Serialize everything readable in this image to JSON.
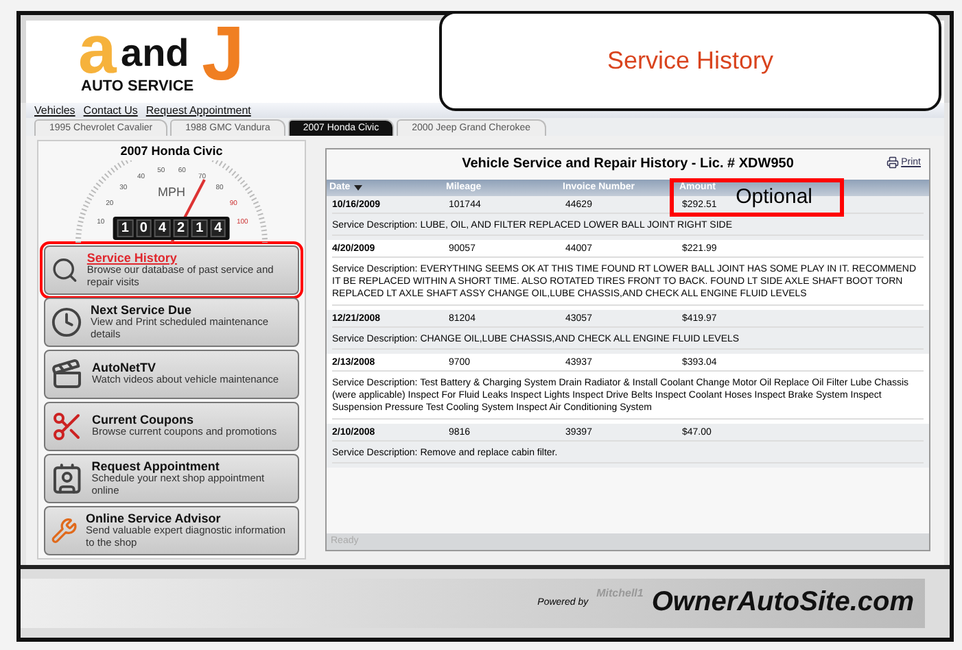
{
  "callout": {
    "text": "Service History"
  },
  "logo": {
    "letter_a": "a",
    "word": "and",
    "letter_j": "J",
    "tagline": "AUTO SERVICE"
  },
  "menu": [
    "Vehicles",
    "Contact Us",
    "Request Appointment"
  ],
  "tabs": [
    {
      "label": "1995 Chevrolet Cavalier",
      "selected": false
    },
    {
      "label": "1988 GMC Vandura",
      "selected": false
    },
    {
      "label": "2007 Honda Civic",
      "selected": true
    },
    {
      "label": "2000 Jeep Grand Cherokee",
      "selected": false
    }
  ],
  "vehicle": {
    "name": "2007 Honda Civic",
    "gauge_unit": "MPH",
    "gauge_labels": [
      "10",
      "20",
      "30",
      "40",
      "50",
      "60",
      "70",
      "80",
      "90",
      "100"
    ],
    "odometer": [
      "1",
      "0",
      "4",
      "2",
      "1",
      "4"
    ]
  },
  "sidebar": [
    {
      "kind": "search",
      "title": "Service History",
      "subtitle": "Browse our database of past service and repair visits",
      "selected": true
    },
    {
      "kind": "clock",
      "title": "Next Service Due",
      "subtitle": "View and Print scheduled maintenance details",
      "selected": false
    },
    {
      "kind": "video",
      "title": "AutoNetTV",
      "subtitle": "Watch videos about vehicle maintenance",
      "selected": false
    },
    {
      "kind": "scissors",
      "title": "Current Coupons",
      "subtitle": "Browse current coupons and promotions",
      "selected": false
    },
    {
      "kind": "card",
      "title": "Request Appointment",
      "subtitle": "Schedule your next shop appointment online",
      "selected": false
    },
    {
      "kind": "wrench",
      "title": "Online Service Advisor",
      "subtitle": "Send valuable expert diagnostic information to the shop",
      "selected": false
    }
  ],
  "history": {
    "title": "Vehicle Service and Repair History - Lic. # XDW950",
    "print": "Print",
    "columns": [
      "Date",
      "Mileage",
      "Invoice Number",
      "Amount"
    ],
    "rows": [
      {
        "date": "10/16/2009",
        "mileage": "101744",
        "invoice": "44629",
        "amount": "$292.51",
        "description": "Service Description: LUBE, OIL, AND FILTER REPLACED LOWER BALL JOINT RIGHT SIDE"
      },
      {
        "date": "4/20/2009",
        "mileage": "90057",
        "invoice": "44007",
        "amount": "$221.99",
        "description": "Service Description: EVERYTHING SEEMS OK AT THIS TIME FOUND RT LOWER BALL JOINT HAS SOME PLAY IN IT. RECOMMEND IT BE REPLACED WITHIN A SHORT TIME. ALSO ROTATED TIRES FRONT TO BACK. FOUND LT SIDE AXLE SHAFT BOOT TORN REPLACED LT AXLE SHAFT ASSY CHANGE OIL,LUBE CHASSIS,AND CHECK ALL ENGINE FLUID LEVELS"
      },
      {
        "date": "12/21/2008",
        "mileage": "81204",
        "invoice": "43057",
        "amount": "$419.97",
        "description": "Service Description: CHANGE OIL,LUBE CHASSIS,AND CHECK ALL ENGINE FLUID LEVELS"
      },
      {
        "date": "2/13/2008",
        "mileage": "9700",
        "invoice": "43937",
        "amount": "$393.04",
        "description": "Service Description: Test Battery & Charging System Drain Radiator & Install Coolant Change Motor Oil Replace Oil Filter Lube Chassis (were applicable) Inspect For Fluid Leaks Inspect Lights Inspect Drive Belts Inspect Coolant Hoses Inspect Brake System Inspect Suspension Pressure Test Cooling System Inspect Air Conditioning System"
      },
      {
        "date": "2/10/2008",
        "mileage": "9816",
        "invoice": "39397",
        "amount": "$47.00",
        "description": "Service Description: Remove and replace cabin filter."
      }
    ],
    "status": "Ready",
    "annotation": "Optional"
  },
  "footer": {
    "powered_by": "Powered by",
    "brand": "Mitchell1",
    "site": "OwnerAutoSite.com"
  }
}
